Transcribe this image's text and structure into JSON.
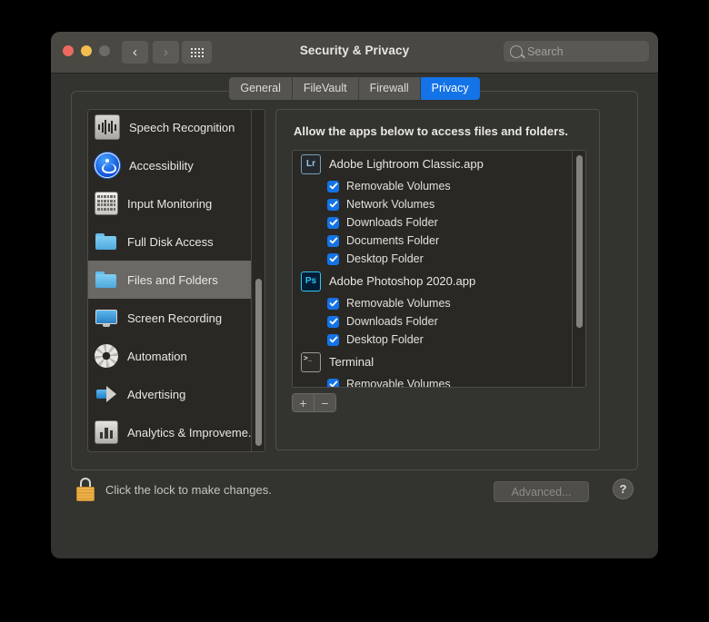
{
  "window": {
    "title": "Security & Privacy",
    "traffic_lights": [
      "close",
      "minimize",
      "zoom"
    ],
    "nav_back_icon": "chevron-left-icon",
    "nav_forward_icon": "chevron-right-icon",
    "grid_icon": "grid-view-icon",
    "accent_color": "#1473e6"
  },
  "search": {
    "placeholder": "Search",
    "icon": "search-icon"
  },
  "tabs": [
    {
      "label": "General",
      "active": false
    },
    {
      "label": "FileVault",
      "active": false
    },
    {
      "label": "Firewall",
      "active": false
    },
    {
      "label": "Privacy",
      "active": true
    }
  ],
  "sidebar": {
    "items": [
      {
        "label": "Speech Recognition",
        "icon": "waveform-icon",
        "selected": false
      },
      {
        "label": "Accessibility",
        "icon": "accessibility-icon",
        "selected": false
      },
      {
        "label": "Input Monitoring",
        "icon": "keyboard-icon",
        "selected": false
      },
      {
        "label": "Full Disk Access",
        "icon": "folder-icon",
        "selected": false
      },
      {
        "label": "Files and Folders",
        "icon": "folder-icon",
        "selected": true
      },
      {
        "label": "Screen Recording",
        "icon": "display-icon",
        "selected": false
      },
      {
        "label": "Automation",
        "icon": "gear-icon",
        "selected": false
      },
      {
        "label": "Advertising",
        "icon": "megaphone-icon",
        "selected": false
      },
      {
        "label": "Analytics & Improveme...",
        "icon": "bar-chart-icon",
        "selected": false
      }
    ]
  },
  "main": {
    "description": "Allow the apps below to access files and folders.",
    "apps": [
      {
        "name": "Adobe Lightroom Classic.app",
        "icon": "lightroom-icon",
        "icon_text": "Lr",
        "permissions": [
          {
            "label": "Removable Volumes",
            "checked": true
          },
          {
            "label": "Network Volumes",
            "checked": true
          },
          {
            "label": "Downloads Folder",
            "checked": true
          },
          {
            "label": "Documents Folder",
            "checked": true
          },
          {
            "label": "Desktop Folder",
            "checked": true
          }
        ]
      },
      {
        "name": "Adobe Photoshop 2020.app",
        "icon": "photoshop-icon",
        "icon_text": "Ps",
        "permissions": [
          {
            "label": "Removable Volumes",
            "checked": true
          },
          {
            "label": "Downloads Folder",
            "checked": true
          },
          {
            "label": "Desktop Folder",
            "checked": true
          }
        ]
      },
      {
        "name": "Terminal",
        "icon": "terminal-icon",
        "icon_text": "",
        "permissions": [
          {
            "label": "Removable Volumes",
            "checked": true
          }
        ]
      }
    ],
    "add_label": "+",
    "remove_label": "−"
  },
  "footer": {
    "lock_icon": "lock-closed-icon",
    "lock_text": "Click the lock to make changes.",
    "advanced_label": "Advanced...",
    "help_label": "?"
  }
}
